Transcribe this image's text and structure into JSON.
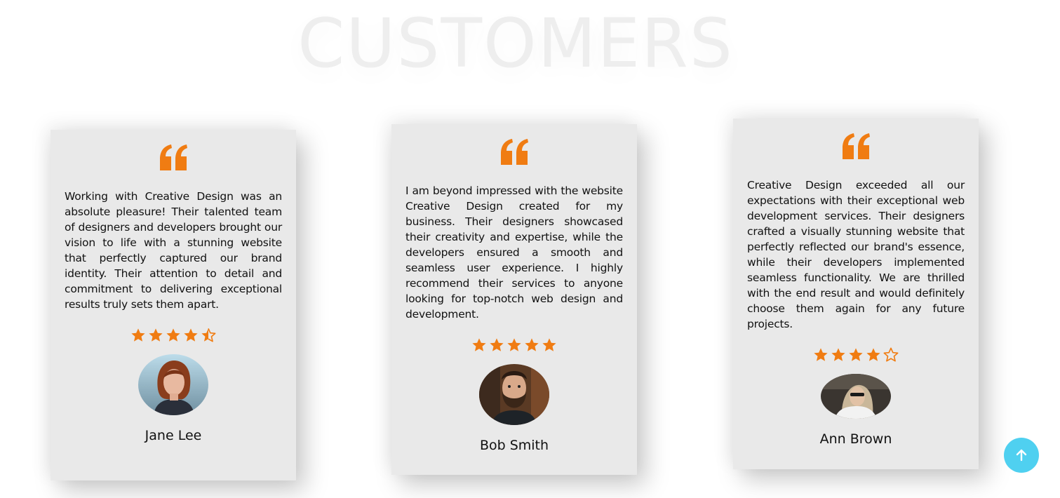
{
  "section": {
    "title": "CUSTOMERS"
  },
  "colors": {
    "accent": "#f07c12",
    "card_bg": "#e9e9e9",
    "scroll_button": "#4fd0f0"
  },
  "testimonials": [
    {
      "quote": "Working with Creative Design was an absolute pleasure! Their talented team of designers and developers brought our vision to life with a stunning website that perfectly captured our brand identity. Their attention to detail and commitment to delivering exceptional results truly sets them apart.",
      "rating": 4.5,
      "name": "Jane Lee",
      "avatar_icon": "woman-red-hair-avatar"
    },
    {
      "quote": "I am beyond impressed with the website Creative Design created for my business. Their designers showcased their creativity and expertise, while the developers ensured a smooth and seamless user experience. I highly recommend their services to anyone looking for top-notch web design and development.",
      "rating": 5,
      "name": "Bob Smith",
      "avatar_icon": "bearded-man-avatar"
    },
    {
      "quote": "Creative Design exceeded all our expectations with their exceptional web development services. Their designers crafted a visually stunning website that perfectly reflected our brand's essence, while their developers implemented seamless functionality. We are thrilled with the end result and would definitely choose them again for any future projects.",
      "rating": 4,
      "name": "Ann Brown",
      "avatar_icon": "woman-sunglasses-avatar"
    }
  ],
  "scroll_top": {
    "icon": "arrow-up-icon"
  }
}
